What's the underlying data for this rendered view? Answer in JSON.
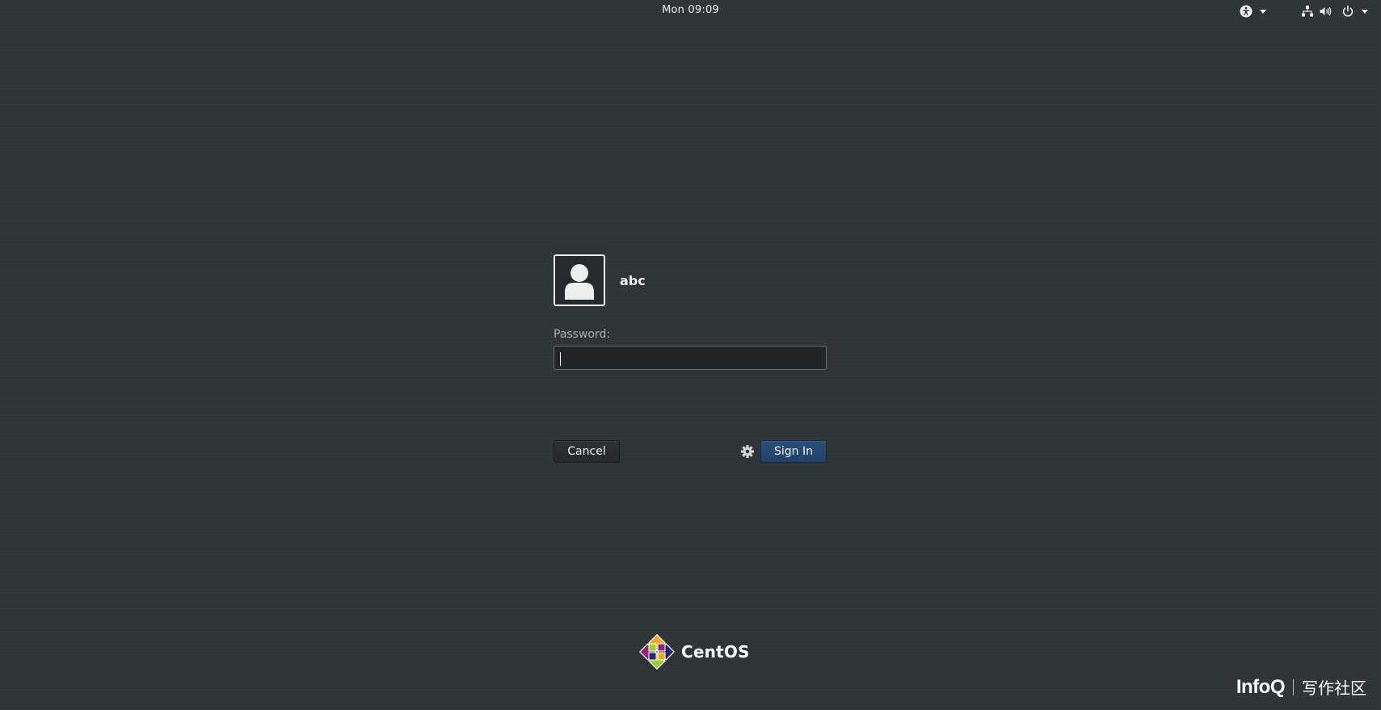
{
  "topbar": {
    "clock": "Mon 09:09",
    "icons": [
      "accessibility-icon",
      "network-icon",
      "volume-icon",
      "power-icon"
    ]
  },
  "login": {
    "username": "abc",
    "password_label": "Password:",
    "password_value": "",
    "cancel_label": "Cancel",
    "signin_label": "Sign In"
  },
  "brand": {
    "name": "CentOS"
  },
  "watermark": {
    "logo": "InfoQ",
    "text": "写作社区"
  },
  "colors": {
    "background": "#2f3437",
    "signin": "#264a74",
    "text": "#eeeeec"
  }
}
